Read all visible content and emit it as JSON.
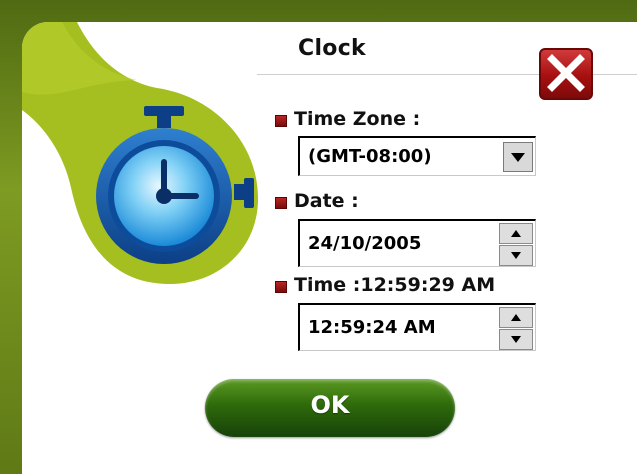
{
  "dialog": {
    "title": "Clock",
    "close_icon": "close-x-icon",
    "illustration_icon": "stopwatch-icon"
  },
  "time_zone": {
    "label": "Time Zone :",
    "value": "(GMT-08:00)",
    "dropdown_icon": "chevron-down-icon"
  },
  "date": {
    "label": "Date :",
    "value": "24/10/2005"
  },
  "time": {
    "label": "Time :12:59:29 AM",
    "value": "12:59:24 AM"
  },
  "ok_button": {
    "label": "OK"
  },
  "colors": {
    "accent_green": "#a4bf1f",
    "frame_green": "#6f8c1a",
    "close_red": "#a60f10",
    "ok_green": "#2e6a0a",
    "clock_blue": "#1b73c7"
  }
}
